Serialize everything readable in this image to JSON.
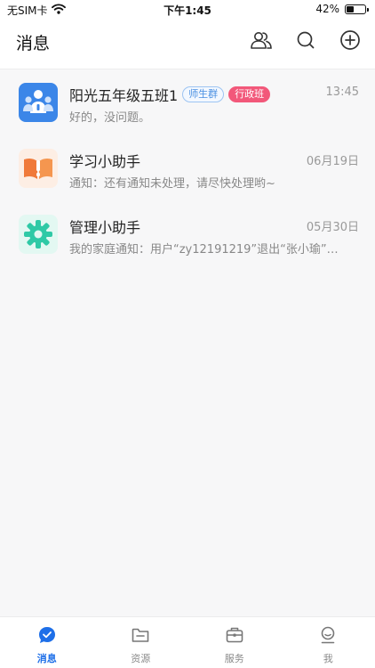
{
  "status_bar": {
    "carrier": "无SIM卡",
    "time": "下午1:45",
    "battery_text": "42%",
    "battery_level": 0.42
  },
  "header": {
    "title": "消息",
    "actions": [
      "contacts-icon",
      "search-icon",
      "add-icon"
    ]
  },
  "conversations": [
    {
      "name": "阳光五年级五班1",
      "tags": [
        "师生群",
        "行政班"
      ],
      "time": "13:45",
      "preview": "好的，没问题。",
      "avatar_color": "#3b86e8",
      "icon": "group-avatar-icon"
    },
    {
      "name": "学习小助手",
      "time": "06月19日",
      "preview": "通知：还有通知未处理，请尽快处理哟~",
      "avatar_color": "#f07a3a",
      "icon": "book-icon"
    },
    {
      "name": "管理小助手",
      "time": "05月30日",
      "preview": "我的家庭通知：用户“zy12191219”退出“张小瑜”…",
      "avatar_color": "#2fc9a6",
      "icon": "gear-icon"
    }
  ],
  "tab_bar": {
    "active_index": 0,
    "tabs": [
      {
        "label": "消息",
        "icon": "message-icon"
      },
      {
        "label": "资源",
        "icon": "folder-icon"
      },
      {
        "label": "服务",
        "icon": "briefcase-icon"
      },
      {
        "label": "我",
        "icon": "profile-icon"
      }
    ]
  },
  "colors": {
    "accent": "#1e6fe8",
    "tag_outline": "#4a90e2",
    "tag_solid": "#f2587a"
  }
}
